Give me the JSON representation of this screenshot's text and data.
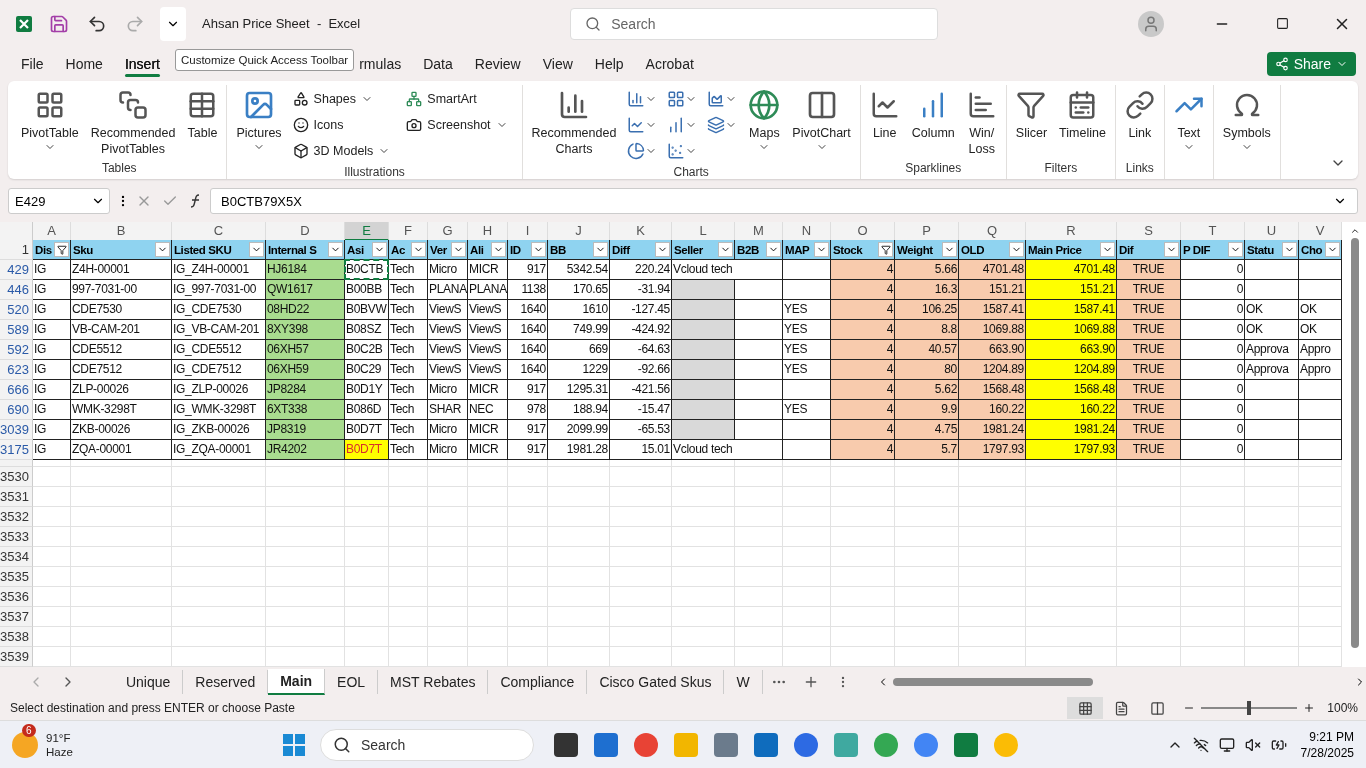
{
  "title_bar": {
    "title": "Ahsan Price Sheet  -  Excel",
    "search_placeholder": "Search"
  },
  "tooltip": "Customize Quick Access Toolbar",
  "menu_tabs": [
    {
      "label": "File",
      "selected": false
    },
    {
      "label": "Home",
      "selected": false
    },
    {
      "label": "Insert",
      "selected": true
    },
    {
      "label": "rmulas",
      "selected": false
    },
    {
      "label": "Data",
      "selected": false
    },
    {
      "label": "Review",
      "selected": false
    },
    {
      "label": "View",
      "selected": false
    },
    {
      "label": "Help",
      "selected": false
    },
    {
      "label": "Acrobat",
      "selected": false
    }
  ],
  "share_button": "Share",
  "ribbon": [
    {
      "label": "Tables",
      "items": [
        {
          "kind": "large",
          "label": "PivotTable",
          "dropdown": true
        },
        {
          "kind": "large",
          "label": "Recommended PivotTables",
          "dropdown": false
        },
        {
          "kind": "large",
          "label": "Table",
          "dropdown": false
        }
      ]
    },
    {
      "label": "Illustrations",
      "items": [
        {
          "kind": "large",
          "label": "Pictures",
          "dropdown": true
        },
        {
          "kind": "small",
          "label": "Shapes",
          "dropdown": true
        },
        {
          "kind": "small",
          "label": "Icons",
          "dropdown": false
        },
        {
          "kind": "small",
          "label": "3D Models",
          "dropdown": true
        },
        {
          "kind": "small",
          "label": "SmartArt",
          "dropdown": false
        },
        {
          "kind": "small",
          "label": "Screenshot",
          "dropdown": true
        }
      ]
    },
    {
      "label": "Charts",
      "items": [
        {
          "kind": "large",
          "label": "Recommended Charts",
          "dropdown": false
        },
        {
          "kind": "icon",
          "dropdown": true
        },
        {
          "kind": "icon",
          "dropdown": true
        },
        {
          "kind": "icon",
          "dropdown": true
        },
        {
          "kind": "icon",
          "dropdown": true
        },
        {
          "kind": "icon",
          "dropdown": true
        },
        {
          "kind": "icon",
          "dropdown": true
        },
        {
          "kind": "icon",
          "dropdown": true
        },
        {
          "kind": "icon",
          "dropdown": true
        },
        {
          "kind": "large",
          "label": "Maps",
          "dropdown": true
        },
        {
          "kind": "large",
          "label": "PivotChart",
          "dropdown": true
        }
      ]
    },
    {
      "label": "Sparklines",
      "items": [
        {
          "kind": "large",
          "label": "Line",
          "dropdown": false
        },
        {
          "kind": "large",
          "label": "Column",
          "dropdown": false
        },
        {
          "kind": "large",
          "label": "Win/ Loss",
          "dropdown": false
        }
      ]
    },
    {
      "label": "Filters",
      "items": [
        {
          "kind": "large",
          "label": "Slicer",
          "dropdown": false
        },
        {
          "kind": "large",
          "label": "Timeline",
          "dropdown": false
        }
      ]
    },
    {
      "label": "Links",
      "items": [
        {
          "kind": "large",
          "label": "Link",
          "dropdown": false
        }
      ]
    },
    {
      "items": [
        {
          "kind": "large",
          "label": "Text",
          "dropdown": true
        }
      ]
    },
    {
      "items": [
        {
          "kind": "large",
          "label": "Symbols",
          "dropdown": true
        }
      ]
    }
  ],
  "formula_bar": {
    "name_box": "E429",
    "formula": "B0CTB79X5X"
  },
  "columns": [
    {
      "letter": "A",
      "header": "Dis",
      "kind": "text",
      "filtered": true,
      "selected": false
    },
    {
      "letter": "B",
      "header": "Sku",
      "kind": "text",
      "filtered": false,
      "selected": false
    },
    {
      "letter": "C",
      "header": "Listed SKU",
      "kind": "text",
      "filtered": false,
      "selected": false
    },
    {
      "letter": "D",
      "header": "Internal S",
      "kind": "text",
      "filtered": false,
      "selected": false,
      "color": "#a9dc8f"
    },
    {
      "letter": "E",
      "header": "Asi",
      "kind": "text",
      "filtered": false,
      "selected": true
    },
    {
      "letter": "F",
      "header": "Ac",
      "kind": "text",
      "filtered": false,
      "selected": false
    },
    {
      "letter": "G",
      "header": "Ver",
      "kind": "text",
      "filtered": false,
      "selected": false
    },
    {
      "letter": "H",
      "header": "Ali",
      "kind": "text",
      "filtered": false,
      "selected": false
    },
    {
      "letter": "I",
      "header": "ID",
      "kind": "number",
      "filtered": false,
      "selected": false
    },
    {
      "letter": "J",
      "header": "BB",
      "kind": "number",
      "filtered": false,
      "selected": false
    },
    {
      "letter": "K",
      "header": "Diff",
      "kind": "number",
      "filtered": false,
      "selected": false
    },
    {
      "letter": "L",
      "header": "Seller",
      "kind": "text",
      "filtered": false,
      "selected": false
    },
    {
      "letter": "M",
      "header": "B2B",
      "kind": "text",
      "filtered": false,
      "selected": false
    },
    {
      "letter": "N",
      "header": "MAP",
      "kind": "text",
      "filtered": false,
      "selected": false
    },
    {
      "letter": "O",
      "header": "Stock",
      "kind": "number",
      "filtered": true,
      "selected": false,
      "color": "#f8cbad"
    },
    {
      "letter": "P",
      "header": "Weight",
      "kind": "number",
      "filtered": false,
      "selected": false,
      "color": "#f8cbad"
    },
    {
      "letter": "Q",
      "header": "OLD",
      "kind": "number",
      "filtered": false,
      "selected": false,
      "color": "#f8cbad"
    },
    {
      "letter": "R",
      "header": "Main Price",
      "kind": "number",
      "filtered": false,
      "selected": false,
      "color": "#ffff00"
    },
    {
      "letter": "S",
      "header": "Dif",
      "kind": "center",
      "filtered": false,
      "selected": false,
      "color": "#f8cbad"
    },
    {
      "letter": "T",
      "header": "P DIF",
      "kind": "number",
      "filtered": false,
      "selected": false
    },
    {
      "letter": "U",
      "header": "Statu",
      "kind": "text",
      "filtered": false,
      "selected": false
    },
    {
      "letter": "V",
      "header": "Cho",
      "kind": "text",
      "filtered": false,
      "selected": false
    }
  ],
  "rows": [
    {
      "number": "429",
      "selected": true,
      "seller_shaded": false,
      "asin_flagged": false,
      "cells": {
        "A": "IG",
        "B": "Z4H-00001",
        "C": "IG_Z4H-00001",
        "D": "HJ6184",
        "E": "B0CTB",
        "F": "Tech",
        "G": "Micro",
        "H": "MICR",
        "I": "917",
        "J": "5342.54",
        "K": "220.24",
        "L": "Vcloud tech",
        "O": "4",
        "P": "5.66",
        "Q": "4701.48",
        "R": "4701.48",
        "S": "TRUE",
        "T": "0"
      }
    },
    {
      "number": "446",
      "selected": false,
      "seller_shaded": true,
      "asin_flagged": false,
      "cells": {
        "A": "IG",
        "B": "997-7031-00",
        "C": "IG_997-7031-00",
        "D": "QW1617",
        "E": "B00BB",
        "F": "Tech",
        "G": "PLANA",
        "H": "PLANA",
        "I": "1138",
        "J": "170.65",
        "K": "-31.94",
        "O": "4",
        "P": "16.3",
        "Q": "151.21",
        "R": "151.21",
        "S": "TRUE",
        "T": "0"
      }
    },
    {
      "number": "520",
      "selected": false,
      "seller_shaded": true,
      "asin_flagged": false,
      "cells": {
        "A": "IG",
        "B": "CDE7530",
        "C": "IG_CDE7530",
        "D": "08HD22",
        "E": "B0BVW",
        "F": "Tech",
        "G": "ViewS",
        "H": "ViewS",
        "I": "1640",
        "J": "1610",
        "K": "-127.45",
        "N": "YES",
        "O": "4",
        "P": "106.25",
        "Q": "1587.41",
        "R": "1587.41",
        "S": "TRUE",
        "T": "0",
        "U": "OK",
        "V": "OK"
      }
    },
    {
      "number": "589",
      "selected": false,
      "seller_shaded": true,
      "asin_flagged": false,
      "cells": {
        "A": "IG",
        "B": "VB-CAM-201",
        "C": "IG_VB-CAM-201",
        "D": "8XY398",
        "E": "B08SZ",
        "F": "Tech",
        "G": "ViewS",
        "H": "ViewS",
        "I": "1640",
        "J": "749.99",
        "K": "-424.92",
        "N": "YES",
        "O": "4",
        "P": "8.8",
        "Q": "1069.88",
        "R": "1069.88",
        "S": "TRUE",
        "T": "0",
        "U": "OK",
        "V": "OK"
      }
    },
    {
      "number": "592",
      "selected": false,
      "seller_shaded": true,
      "asin_flagged": false,
      "cells": {
        "A": "IG",
        "B": "CDE5512",
        "C": "IG_CDE5512",
        "D": "06XH57",
        "E": "B0C2B",
        "F": "Tech",
        "G": "ViewS",
        "H": "ViewS",
        "I": "1640",
        "J": "669",
        "K": "-64.63",
        "N": "YES",
        "O": "4",
        "P": "40.57",
        "Q": "663.90",
        "R": "663.90",
        "S": "TRUE",
        "T": "0",
        "U": "Approva",
        "V": "Appro"
      }
    },
    {
      "number": "623",
      "selected": false,
      "seller_shaded": true,
      "asin_flagged": false,
      "cells": {
        "A": "IG",
        "B": "CDE7512",
        "C": "IG_CDE7512",
        "D": "06XH59",
        "E": "B0C29",
        "F": "Tech",
        "G": "ViewS",
        "H": "ViewS",
        "I": "1640",
        "J": "1229",
        "K": "-92.66",
        "N": "YES",
        "O": "4",
        "P": "80",
        "Q": "1204.89",
        "R": "1204.89",
        "S": "TRUE",
        "T": "0",
        "U": "Approva",
        "V": "Appro"
      }
    },
    {
      "number": "666",
      "selected": false,
      "seller_shaded": true,
      "asin_flagged": false,
      "cells": {
        "A": "IG",
        "B": "ZLP-00026",
        "C": "IG_ZLP-00026",
        "D": "JP8284",
        "E": "B0D1Y",
        "F": "Tech",
        "G": "Micro",
        "H": "MICR",
        "I": "917",
        "J": "1295.31",
        "K": "-421.56",
        "O": "4",
        "P": "5.62",
        "Q": "1568.48",
        "R": "1568.48",
        "S": "TRUE",
        "T": "0"
      }
    },
    {
      "number": "690",
      "selected": false,
      "seller_shaded": true,
      "asin_flagged": false,
      "cells": {
        "A": "IG",
        "B": "WMK-3298T",
        "C": "IG_WMK-3298T",
        "D": "6XT338",
        "E": "B086D",
        "F": "Tech",
        "G": "SHAR",
        "H": "NEC",
        "I": "978",
        "J": "188.94",
        "K": "-15.47",
        "N": "YES",
        "O": "4",
        "P": "9.9",
        "Q": "160.22",
        "R": "160.22",
        "S": "TRUE",
        "T": "0"
      }
    },
    {
      "number": "3039",
      "selected": false,
      "seller_shaded": true,
      "asin_flagged": false,
      "cells": {
        "A": "IG",
        "B": "ZKB-00026",
        "C": "IG_ZKB-00026",
        "D": "JP8319",
        "E": "B0D7T",
        "F": "Tech",
        "G": "Micro",
        "H": "MICR",
        "I": "917",
        "J": "2099.99",
        "K": "-65.53",
        "O": "4",
        "P": "4.75",
        "Q": "1981.24",
        "R": "1981.24",
        "S": "TRUE",
        "T": "0"
      }
    },
    {
      "number": "3175",
      "selected": false,
      "seller_shaded": false,
      "asin_flagged": true,
      "cells": {
        "A": "IG",
        "B": "ZQA-00001",
        "C": "IG_ZQA-00001",
        "D": "JR4202",
        "E": "B0D7T",
        "F": "Tech",
        "G": "Micro",
        "H": "MICR",
        "I": "917",
        "J": "1981.28",
        "K": "15.01",
        "L": "Vcloud tech",
        "O": "4",
        "P": "5.7",
        "Q": "1797.93",
        "R": "1797.93",
        "S": "TRUE",
        "T": "0"
      }
    }
  ],
  "header_row_number": "1",
  "empty_rows": [
    "3530",
    "3531",
    "3532",
    "3533",
    "3534",
    "3535",
    "3536",
    "3537",
    "3538",
    "3539"
  ],
  "sheet_tabs": [
    {
      "label": "Unique",
      "selected": false
    },
    {
      "label": "Reserved",
      "selected": false
    },
    {
      "label": "Main",
      "selected": true
    },
    {
      "label": "EOL",
      "selected": false
    },
    {
      "label": "MST Rebates",
      "selected": false
    },
    {
      "label": "Compliance",
      "selected": false
    },
    {
      "label": "Cisco Gated Skus",
      "selected": false
    },
    {
      "label": "W",
      "selected": false
    }
  ],
  "status_bar": {
    "message": "Select destination and press ENTER or choose Paste",
    "zoom": "100%",
    "zoom_level": {
      "level": 0.5
    }
  },
  "taskbar": {
    "weather_badge": "6",
    "temperature": "91°F",
    "condition": "Haze",
    "search_placeholder": "Search",
    "time": "9:21 PM",
    "date": "7/28/2025"
  }
}
